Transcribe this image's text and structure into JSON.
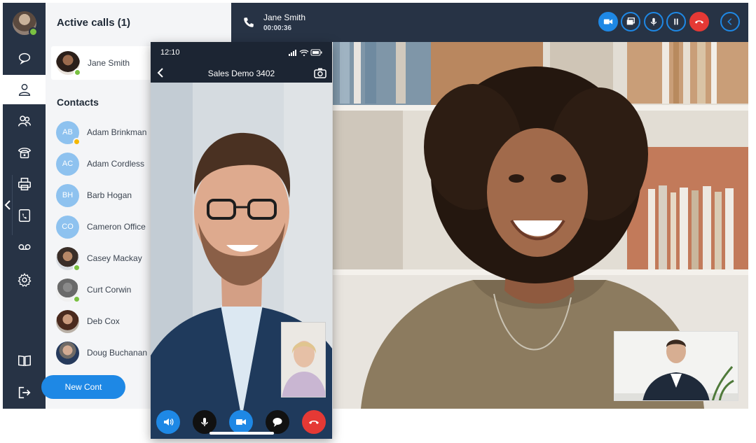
{
  "sidebar": {
    "avatar": "user-avatar",
    "items": [
      {
        "icon": "chat-bubble-icon",
        "active": false
      },
      {
        "icon": "person-icon",
        "active": true
      },
      {
        "icon": "group-icon",
        "active": false
      },
      {
        "icon": "desk-phone-icon",
        "active": false
      },
      {
        "icon": "fax-printer-icon",
        "active": false
      },
      {
        "icon": "call-history-icon",
        "active": false
      },
      {
        "icon": "voicemail-icon",
        "active": false
      },
      {
        "icon": "settings-gear-icon",
        "active": false
      }
    ],
    "bottom_items": [
      {
        "icon": "book-icon"
      },
      {
        "icon": "logout-icon"
      }
    ],
    "collapse_icon": "chevron-left-icon"
  },
  "panel": {
    "active_calls_title": "Active calls (1)",
    "active_call_name": "Jane Smith",
    "contacts_title": "Contacts",
    "contacts": [
      {
        "initials": "AB",
        "name": "Adam Brinkman",
        "status": "away"
      },
      {
        "initials": "AC",
        "name": "Adam Cordless",
        "status": ""
      },
      {
        "initials": "BH",
        "name": "Barb Hogan",
        "status": ""
      },
      {
        "initials": "CO",
        "name": "Cameron Office",
        "status": ""
      },
      {
        "initials": "",
        "name": "Casey Mackay",
        "status": "online"
      },
      {
        "initials": "",
        "name": "Curt Corwin",
        "status": "online"
      },
      {
        "initials": "",
        "name": "Deb Cox",
        "status": ""
      },
      {
        "initials": "",
        "name": "Doug Buchanan",
        "status": ""
      }
    ],
    "new_contact_label": "New Cont"
  },
  "call": {
    "name": "Jane Smith",
    "duration": "00:00:36",
    "controls": [
      {
        "icon": "video-camera-icon",
        "style": "filled"
      },
      {
        "icon": "screen-share-icon",
        "style": "outline"
      },
      {
        "icon": "microphone-icon",
        "style": "outline"
      },
      {
        "icon": "pause-icon",
        "style": "outline"
      },
      {
        "icon": "hang-up-icon",
        "style": "red"
      },
      {
        "icon": "chevron-left-icon",
        "style": "outline"
      }
    ]
  },
  "mobile": {
    "time": "12:10",
    "title": "Sales Demo 3402",
    "controls": [
      {
        "icon": "speaker-icon",
        "color": "#1e88e5"
      },
      {
        "icon": "microphone-icon",
        "color": "#111111"
      },
      {
        "icon": "video-camera-icon",
        "color": "#1e88e5"
      },
      {
        "icon": "chat-bubble-icon",
        "color": "#111111"
      },
      {
        "icon": "hang-up-icon",
        "color": "#e53935"
      }
    ]
  },
  "colors": {
    "rail": "#273345",
    "accent": "#1e88e5",
    "danger": "#e53935",
    "online": "#7ac142",
    "away": "#f5b800"
  }
}
